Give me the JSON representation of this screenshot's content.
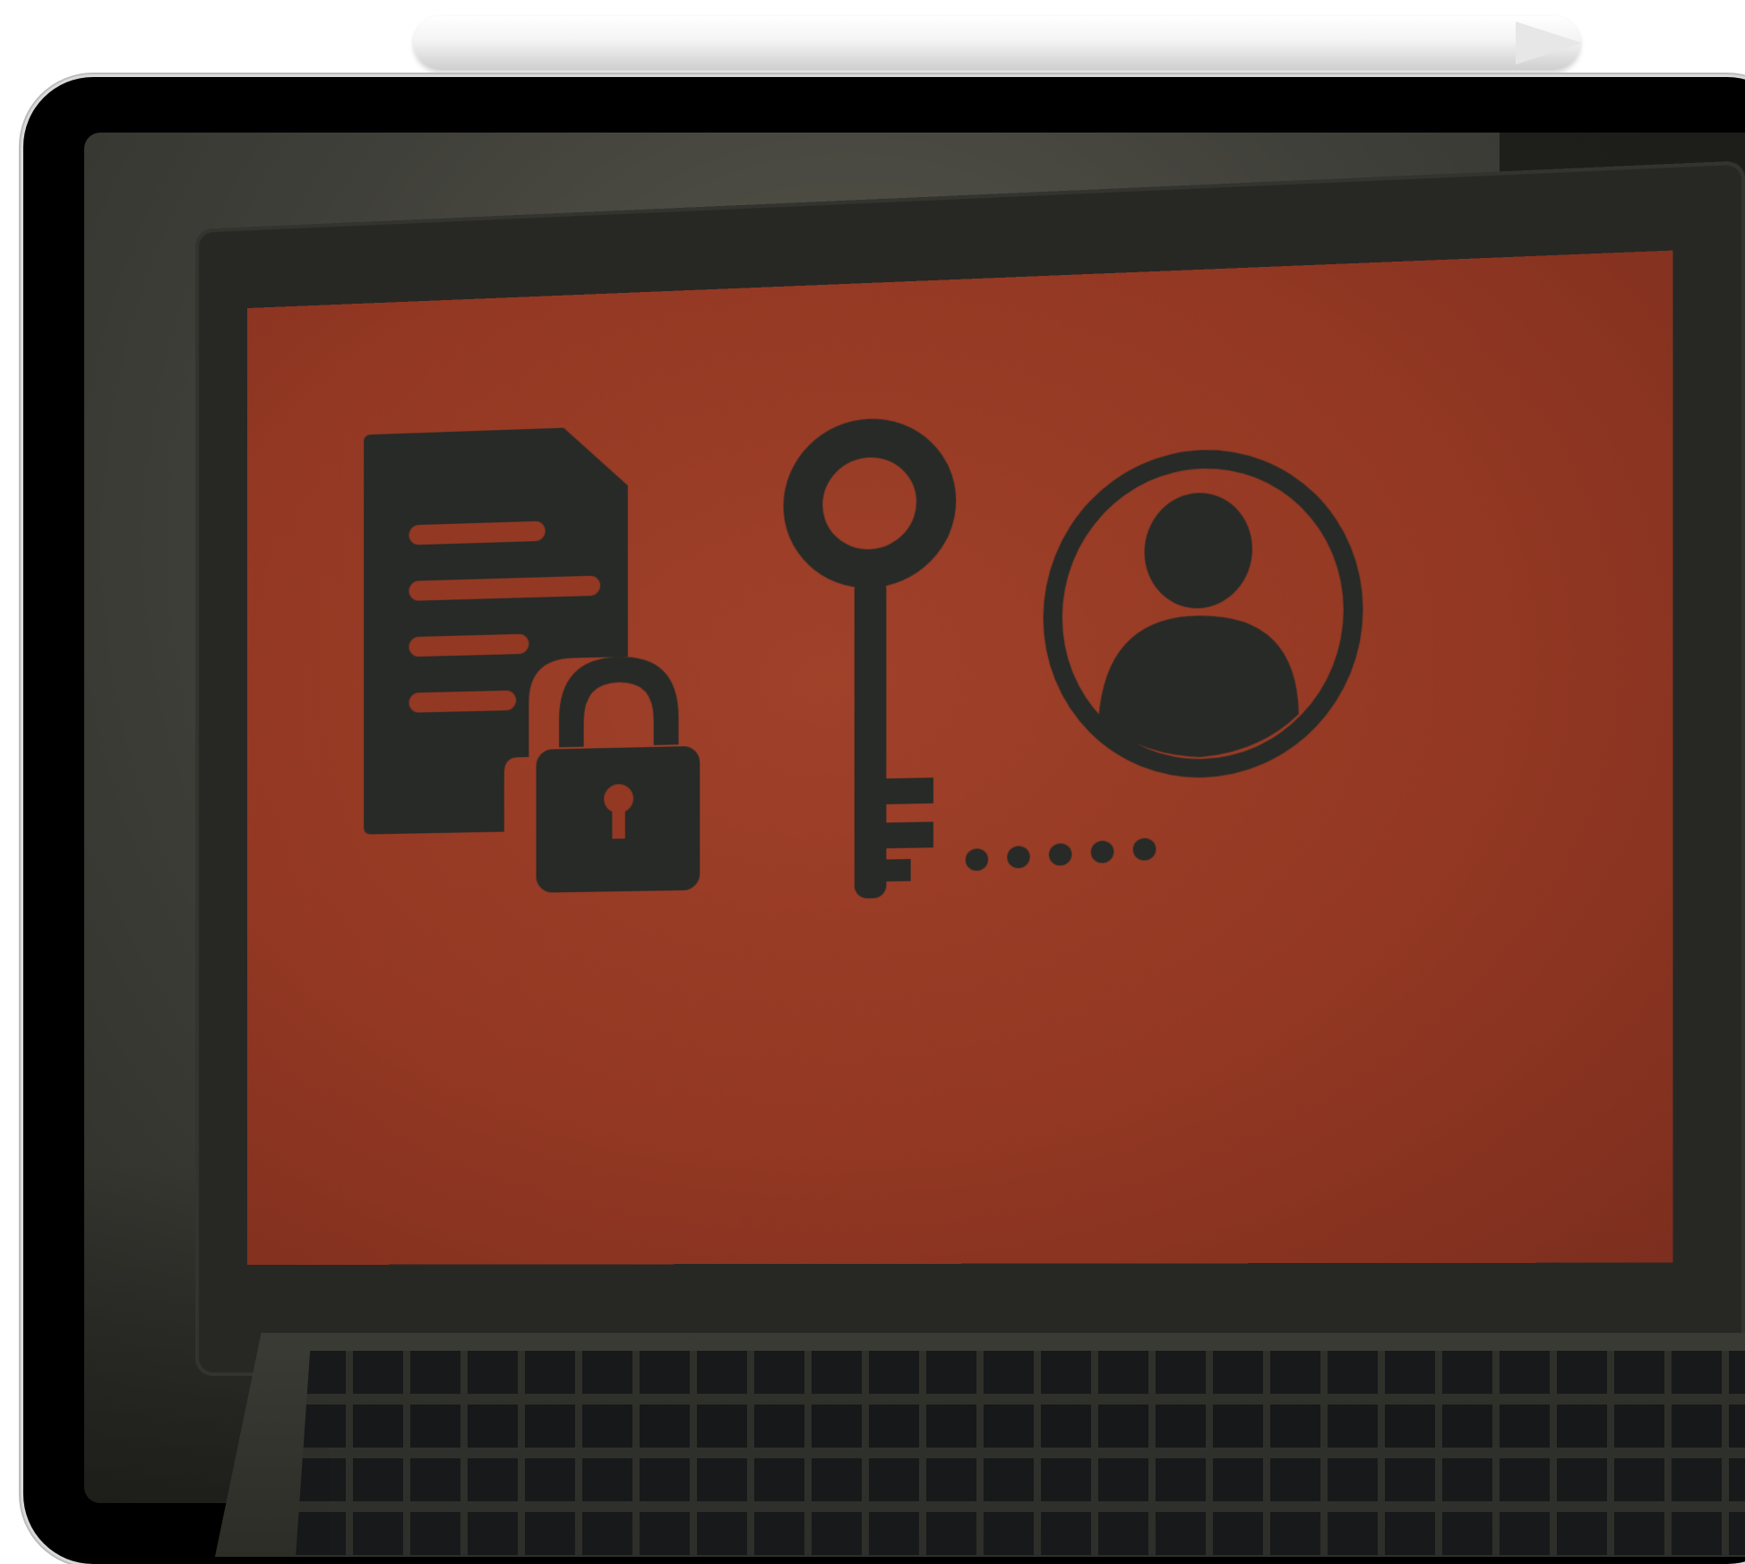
{
  "scene": {
    "objects": [
      "stylus",
      "tablet",
      "laptop"
    ],
    "colors": {
      "laptop_screen_background": "#933823",
      "icon_fill": "#272a26",
      "tablet_bezel": "#000000",
      "stylus": "#f2f2f2"
    }
  },
  "laptop_screen": {
    "icons": [
      "locked-document-icon",
      "key-icon",
      "user-avatar-icon"
    ],
    "document_text_lines": 4,
    "key_trail_dots": 5
  }
}
